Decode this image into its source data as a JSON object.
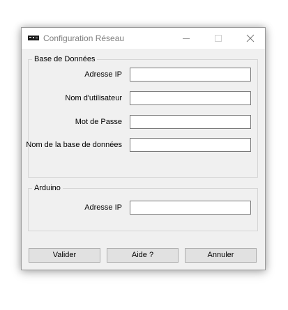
{
  "window": {
    "title": "Configuration Réseau",
    "icon": "app-logo-icon"
  },
  "titlebar_controls": {
    "minimize_icon": "minimize-icon",
    "maximize_icon": "maximize-icon",
    "close_icon": "close-icon"
  },
  "database_group": {
    "legend": "Base de Données",
    "fields": [
      {
        "label": "Adresse IP",
        "value": ""
      },
      {
        "label": "Nom d'utilisateur",
        "value": ""
      },
      {
        "label": "Mot de Passe",
        "value": ""
      },
      {
        "label": "Nom de la base de données",
        "value": ""
      }
    ]
  },
  "arduino_group": {
    "legend": "Arduino",
    "fields": [
      {
        "label": "Adresse IP",
        "value": ""
      }
    ]
  },
  "buttons": {
    "validate": "Valider",
    "help": "Aide ?",
    "cancel": "Annuler"
  }
}
